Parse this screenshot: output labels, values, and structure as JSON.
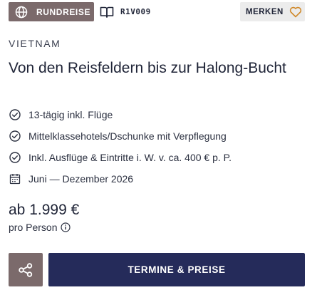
{
  "header": {
    "type_badge": {
      "label": "RUNDREISE",
      "icon": "globe-icon",
      "background": "#7b6a6b"
    },
    "trip_code": {
      "label": "R1V009",
      "icon": "book-icon"
    },
    "bookmark": {
      "label": "MERKEN",
      "icon": "heart-icon",
      "icon_color": "#d08a2c"
    }
  },
  "trip": {
    "country": "VIETNAM",
    "title": "Von den Reisfeldern bis zur Halong-Bucht",
    "features": [
      {
        "icon": "check-circle-icon",
        "text": "13-tägig inkl. Flüge"
      },
      {
        "icon": "check-circle-icon",
        "text": "Mittelklassehotels/Dschunke mit Verpflegung"
      },
      {
        "icon": "check-circle-icon",
        "text": "Inkl. Ausflüge & Eintritte i. W. v. ca. 400 € p. P."
      },
      {
        "icon": "calendar-icon",
        "text": "Juni — Dezember 2026"
      }
    ]
  },
  "pricing": {
    "price": "ab 1.999 €",
    "per_person": "pro Person",
    "info_icon": "info-icon"
  },
  "actions": {
    "share": {
      "icon": "share-icon",
      "background": "#7b6a6b"
    },
    "primary": {
      "label": "TERMINE & PREISE",
      "background": "#252b5a"
    }
  }
}
